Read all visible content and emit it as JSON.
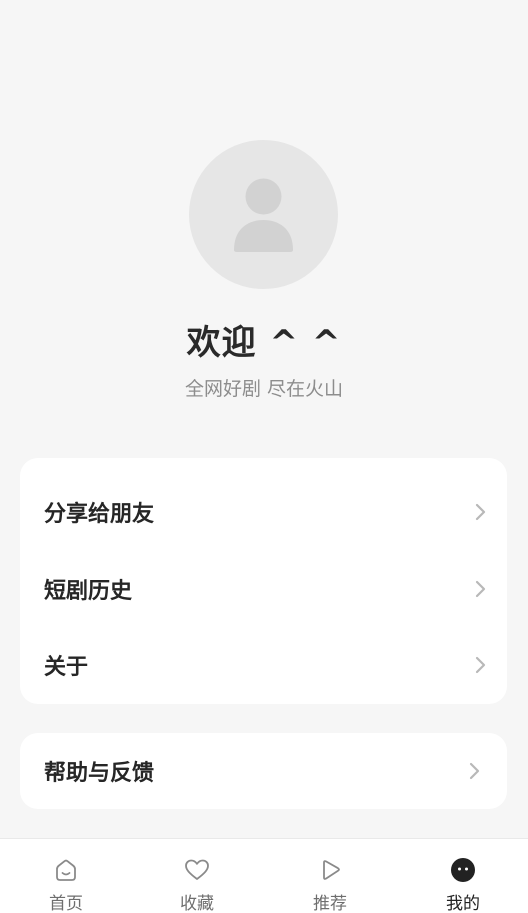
{
  "profile": {
    "welcome": "欢迎 ^ ^",
    "tagline": "全网好剧 尽在火山"
  },
  "menu_primary": [
    {
      "label": "分享给朋友"
    },
    {
      "label": "短剧历史"
    },
    {
      "label": "关于"
    }
  ],
  "menu_secondary": [
    {
      "label": "帮助与反馈"
    }
  ],
  "tabbar": {
    "active": "我的",
    "tabs": [
      {
        "label": "首页",
        "icon": "home-icon"
      },
      {
        "label": "收藏",
        "icon": "heart-icon"
      },
      {
        "label": "推荐",
        "icon": "play-icon"
      },
      {
        "label": "我的",
        "icon": "profile-face-icon"
      }
    ]
  },
  "colors": {
    "background": "#f6f6f6",
    "card": "#ffffff",
    "text_primary": "#262626",
    "text_secondary": "#8d8d8d",
    "tab_inactive": "#6e6e6e"
  }
}
